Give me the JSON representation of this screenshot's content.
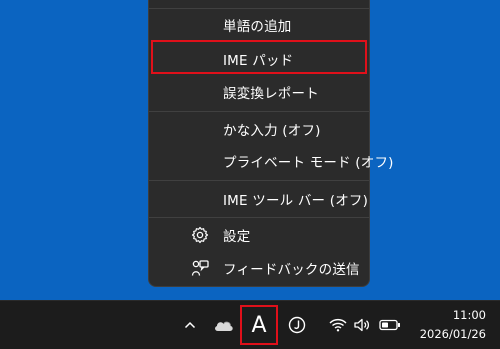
{
  "menu": {
    "items": [
      {
        "label": "単語の追加",
        "icon": null
      },
      {
        "label": "IME パッド",
        "icon": null,
        "highlighted": true
      },
      {
        "label": "誤変換レポート",
        "icon": null
      },
      {
        "label": "かな入力 (オフ)",
        "icon": null
      },
      {
        "label": "プライベート モード (オフ)",
        "icon": null
      },
      {
        "label": "IME ツール バー (オフ)",
        "icon": null
      },
      {
        "label": "設定",
        "icon": "gear-icon"
      },
      {
        "label": "フィードバックの送信",
        "icon": "feedback-icon"
      }
    ]
  },
  "taskbar": {
    "ime_mode": "A",
    "clock_time": "11:00",
    "clock_date": "2026/01/26",
    "icons": [
      "chevron-up-icon",
      "onedrive-cloud-icon",
      "ime-mode-icon",
      "ime-kana-icon",
      "wifi-icon",
      "speaker-icon",
      "battery-icon"
    ]
  },
  "colors": {
    "desktop": "#0b64c1",
    "menu_bg": "#2b2b2b",
    "taskbar_bg": "#1c1c1c",
    "highlight": "#e0101a"
  }
}
